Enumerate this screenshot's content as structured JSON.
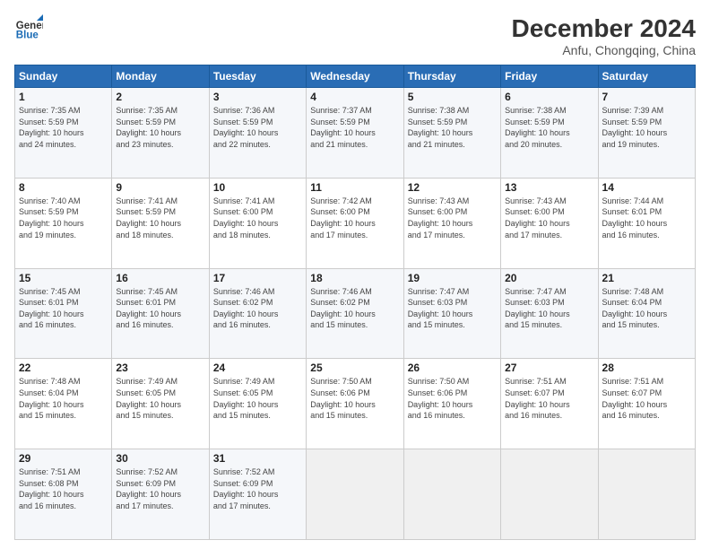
{
  "header": {
    "logo_line1": "General",
    "logo_line2": "Blue",
    "month": "December 2024",
    "location": "Anfu, Chongqing, China"
  },
  "weekdays": [
    "Sunday",
    "Monday",
    "Tuesday",
    "Wednesday",
    "Thursday",
    "Friday",
    "Saturday"
  ],
  "weeks": [
    [
      {
        "day": "1",
        "info": "Sunrise: 7:35 AM\nSunset: 5:59 PM\nDaylight: 10 hours\nand 24 minutes."
      },
      {
        "day": "2",
        "info": "Sunrise: 7:35 AM\nSunset: 5:59 PM\nDaylight: 10 hours\nand 23 minutes."
      },
      {
        "day": "3",
        "info": "Sunrise: 7:36 AM\nSunset: 5:59 PM\nDaylight: 10 hours\nand 22 minutes."
      },
      {
        "day": "4",
        "info": "Sunrise: 7:37 AM\nSunset: 5:59 PM\nDaylight: 10 hours\nand 21 minutes."
      },
      {
        "day": "5",
        "info": "Sunrise: 7:38 AM\nSunset: 5:59 PM\nDaylight: 10 hours\nand 21 minutes."
      },
      {
        "day": "6",
        "info": "Sunrise: 7:38 AM\nSunset: 5:59 PM\nDaylight: 10 hours\nand 20 minutes."
      },
      {
        "day": "7",
        "info": "Sunrise: 7:39 AM\nSunset: 5:59 PM\nDaylight: 10 hours\nand 19 minutes."
      }
    ],
    [
      {
        "day": "8",
        "info": "Sunrise: 7:40 AM\nSunset: 5:59 PM\nDaylight: 10 hours\nand 19 minutes."
      },
      {
        "day": "9",
        "info": "Sunrise: 7:41 AM\nSunset: 5:59 PM\nDaylight: 10 hours\nand 18 minutes."
      },
      {
        "day": "10",
        "info": "Sunrise: 7:41 AM\nSunset: 6:00 PM\nDaylight: 10 hours\nand 18 minutes."
      },
      {
        "day": "11",
        "info": "Sunrise: 7:42 AM\nSunset: 6:00 PM\nDaylight: 10 hours\nand 17 minutes."
      },
      {
        "day": "12",
        "info": "Sunrise: 7:43 AM\nSunset: 6:00 PM\nDaylight: 10 hours\nand 17 minutes."
      },
      {
        "day": "13",
        "info": "Sunrise: 7:43 AM\nSunset: 6:00 PM\nDaylight: 10 hours\nand 17 minutes."
      },
      {
        "day": "14",
        "info": "Sunrise: 7:44 AM\nSunset: 6:01 PM\nDaylight: 10 hours\nand 16 minutes."
      }
    ],
    [
      {
        "day": "15",
        "info": "Sunrise: 7:45 AM\nSunset: 6:01 PM\nDaylight: 10 hours\nand 16 minutes."
      },
      {
        "day": "16",
        "info": "Sunrise: 7:45 AM\nSunset: 6:01 PM\nDaylight: 10 hours\nand 16 minutes."
      },
      {
        "day": "17",
        "info": "Sunrise: 7:46 AM\nSunset: 6:02 PM\nDaylight: 10 hours\nand 16 minutes."
      },
      {
        "day": "18",
        "info": "Sunrise: 7:46 AM\nSunset: 6:02 PM\nDaylight: 10 hours\nand 15 minutes."
      },
      {
        "day": "19",
        "info": "Sunrise: 7:47 AM\nSunset: 6:03 PM\nDaylight: 10 hours\nand 15 minutes."
      },
      {
        "day": "20",
        "info": "Sunrise: 7:47 AM\nSunset: 6:03 PM\nDaylight: 10 hours\nand 15 minutes."
      },
      {
        "day": "21",
        "info": "Sunrise: 7:48 AM\nSunset: 6:04 PM\nDaylight: 10 hours\nand 15 minutes."
      }
    ],
    [
      {
        "day": "22",
        "info": "Sunrise: 7:48 AM\nSunset: 6:04 PM\nDaylight: 10 hours\nand 15 minutes."
      },
      {
        "day": "23",
        "info": "Sunrise: 7:49 AM\nSunset: 6:05 PM\nDaylight: 10 hours\nand 15 minutes."
      },
      {
        "day": "24",
        "info": "Sunrise: 7:49 AM\nSunset: 6:05 PM\nDaylight: 10 hours\nand 15 minutes."
      },
      {
        "day": "25",
        "info": "Sunrise: 7:50 AM\nSunset: 6:06 PM\nDaylight: 10 hours\nand 15 minutes."
      },
      {
        "day": "26",
        "info": "Sunrise: 7:50 AM\nSunset: 6:06 PM\nDaylight: 10 hours\nand 16 minutes."
      },
      {
        "day": "27",
        "info": "Sunrise: 7:51 AM\nSunset: 6:07 PM\nDaylight: 10 hours\nand 16 minutes."
      },
      {
        "day": "28",
        "info": "Sunrise: 7:51 AM\nSunset: 6:07 PM\nDaylight: 10 hours\nand 16 minutes."
      }
    ],
    [
      {
        "day": "29",
        "info": "Sunrise: 7:51 AM\nSunset: 6:08 PM\nDaylight: 10 hours\nand 16 minutes."
      },
      {
        "day": "30",
        "info": "Sunrise: 7:52 AM\nSunset: 6:09 PM\nDaylight: 10 hours\nand 17 minutes."
      },
      {
        "day": "31",
        "info": "Sunrise: 7:52 AM\nSunset: 6:09 PM\nDaylight: 10 hours\nand 17 minutes."
      },
      {
        "day": "",
        "info": ""
      },
      {
        "day": "",
        "info": ""
      },
      {
        "day": "",
        "info": ""
      },
      {
        "day": "",
        "info": ""
      }
    ]
  ]
}
